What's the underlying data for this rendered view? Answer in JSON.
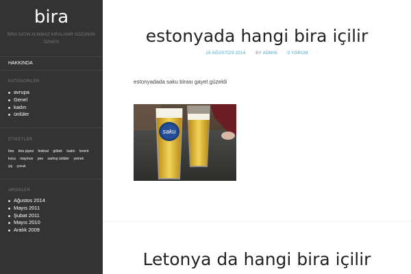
{
  "site": {
    "title": "bira",
    "description": "bira satın alınmaz kiralanır sözünün öznesi"
  },
  "menu": {
    "about_label": "Hakkında"
  },
  "widgets": {
    "categories": {
      "title": "Kategoriler",
      "items": [
        "avrupa",
        "Genel",
        "kadın",
        "ünlüler"
      ]
    },
    "tags": {
      "title": "Etiketler",
      "items": [
        "bira",
        "bira şişesi",
        "festival",
        "göbek",
        "kadın",
        "levent",
        "kırca",
        "maymun",
        "pee",
        "sarhoş ünlüler",
        "yemek",
        "çiş",
        "çocuk"
      ]
    },
    "archives": {
      "title": "Arşivler",
      "items": [
        "Ağustos 2014",
        "Mayıs 2011",
        "Şubat 2011",
        "Mayıs 2010",
        "Aralık 2009"
      ]
    }
  },
  "post1": {
    "title": "estonyada hangi bira içilir",
    "date": "15 Ağustos 2014",
    "by_label": "by",
    "author": "admin",
    "comments": "0 Yorum",
    "text": "estonyadada saku birası gayet güzeldi",
    "image_label": "saku"
  },
  "post2": {
    "title": "Letonya da hangi bira içilir"
  },
  "colors": {
    "sidebar_bg": "#333333",
    "accent": "#3aa0c8"
  }
}
